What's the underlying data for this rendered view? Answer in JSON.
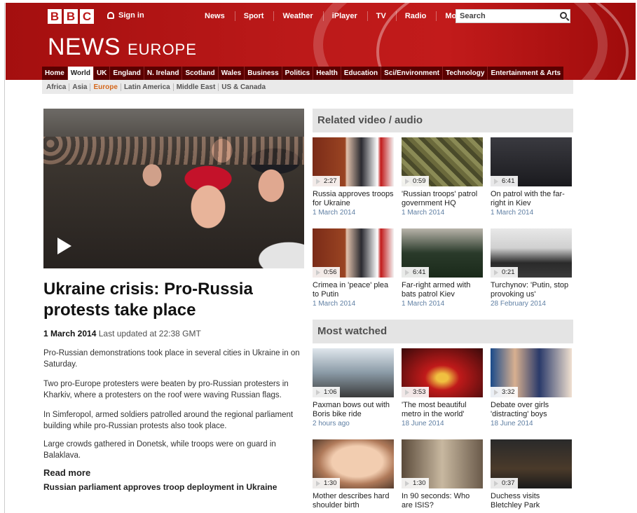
{
  "masthead": {
    "logo_letters": [
      "B",
      "B",
      "C"
    ],
    "signin_label": "Sign in",
    "nav": [
      "News",
      "Sport",
      "Weather",
      "iPlayer",
      "TV",
      "Radio",
      "More..."
    ],
    "search_placeholder": "Search",
    "title": "NEWS",
    "region": "EUROPE"
  },
  "section_nav": [
    "Home",
    "World",
    "UK",
    "England",
    "N. Ireland",
    "Scotland",
    "Wales",
    "Business",
    "Politics",
    "Health",
    "Education",
    "Sci/Environment",
    "Technology",
    "Entertainment & Arts"
  ],
  "section_nav_active": "World",
  "sub_nav": [
    "Africa",
    "Asia",
    "Europe",
    "Latin America",
    "Middle East",
    "US & Canada"
  ],
  "sub_nav_active": "Europe",
  "article": {
    "headline": "Ukraine crisis: Pro-Russia protests take place",
    "date": "1 March 2014",
    "updated": "Last updated at 22:38 GMT",
    "paragraphs": [
      "Pro-Russian demonstrations took place in several cities in Ukraine in on Saturday.",
      "Two pro-Europe protesters were beaten by pro-Russian protesters in Kharkiv, where a protesters on the roof were waving Russian flags.",
      "In Simferopol, armed soldiers patrolled around the regional parliament building while pro-Russian protests also took place.",
      "Large crowds gathered in Donetsk, while troops were on guard in Balaklava."
    ],
    "read_more_label": "Read more",
    "read_more_link": "Russian parliament approves troop deployment in Ukraine"
  },
  "related": {
    "heading": "Related video / audio",
    "items": [
      {
        "duration": "2:27",
        "title": "Russia approves troops for Ukraine",
        "date": "1 March 2014"
      },
      {
        "duration": "0:59",
        "title": "'Russian troops' patrol government HQ",
        "date": "1 March 2014"
      },
      {
        "duration": "6:41",
        "title": "On patrol with the far-right in Kiev",
        "date": "1 March 2014"
      },
      {
        "duration": "0:56",
        "title": "Crimea in 'peace' plea to Putin",
        "date": "1 March 2014"
      },
      {
        "duration": "6:41",
        "title": "Far-right armed with bats patrol Kiev",
        "date": "1 March 2014"
      },
      {
        "duration": "0:21",
        "title": "Turchynov: 'Putin, stop provoking us'",
        "date": "28 February 2014"
      }
    ]
  },
  "most_watched": {
    "heading": "Most watched",
    "items": [
      {
        "duration": "1:06",
        "title": "Paxman bows out with Boris bike ride",
        "date": "2 hours ago"
      },
      {
        "duration": "3:53",
        "title": "'The most beautiful metro in the world'",
        "date": "18 June 2014"
      },
      {
        "duration": "3:32",
        "title": "Debate over girls 'distracting' boys",
        "date": "18 June 2014"
      },
      {
        "duration": "1:30",
        "title": "Mother describes hard shoulder birth",
        "date": ""
      },
      {
        "duration": "1:30",
        "title": "In 90 seconds: Who are ISIS?",
        "date": ""
      },
      {
        "duration": "0:37",
        "title": "Duchess visits Bletchley Park",
        "date": ""
      }
    ]
  },
  "colors": {
    "brand_red": "#bb1919",
    "active_subnav": "#d4671b",
    "date_blue": "#5f7fa3"
  }
}
